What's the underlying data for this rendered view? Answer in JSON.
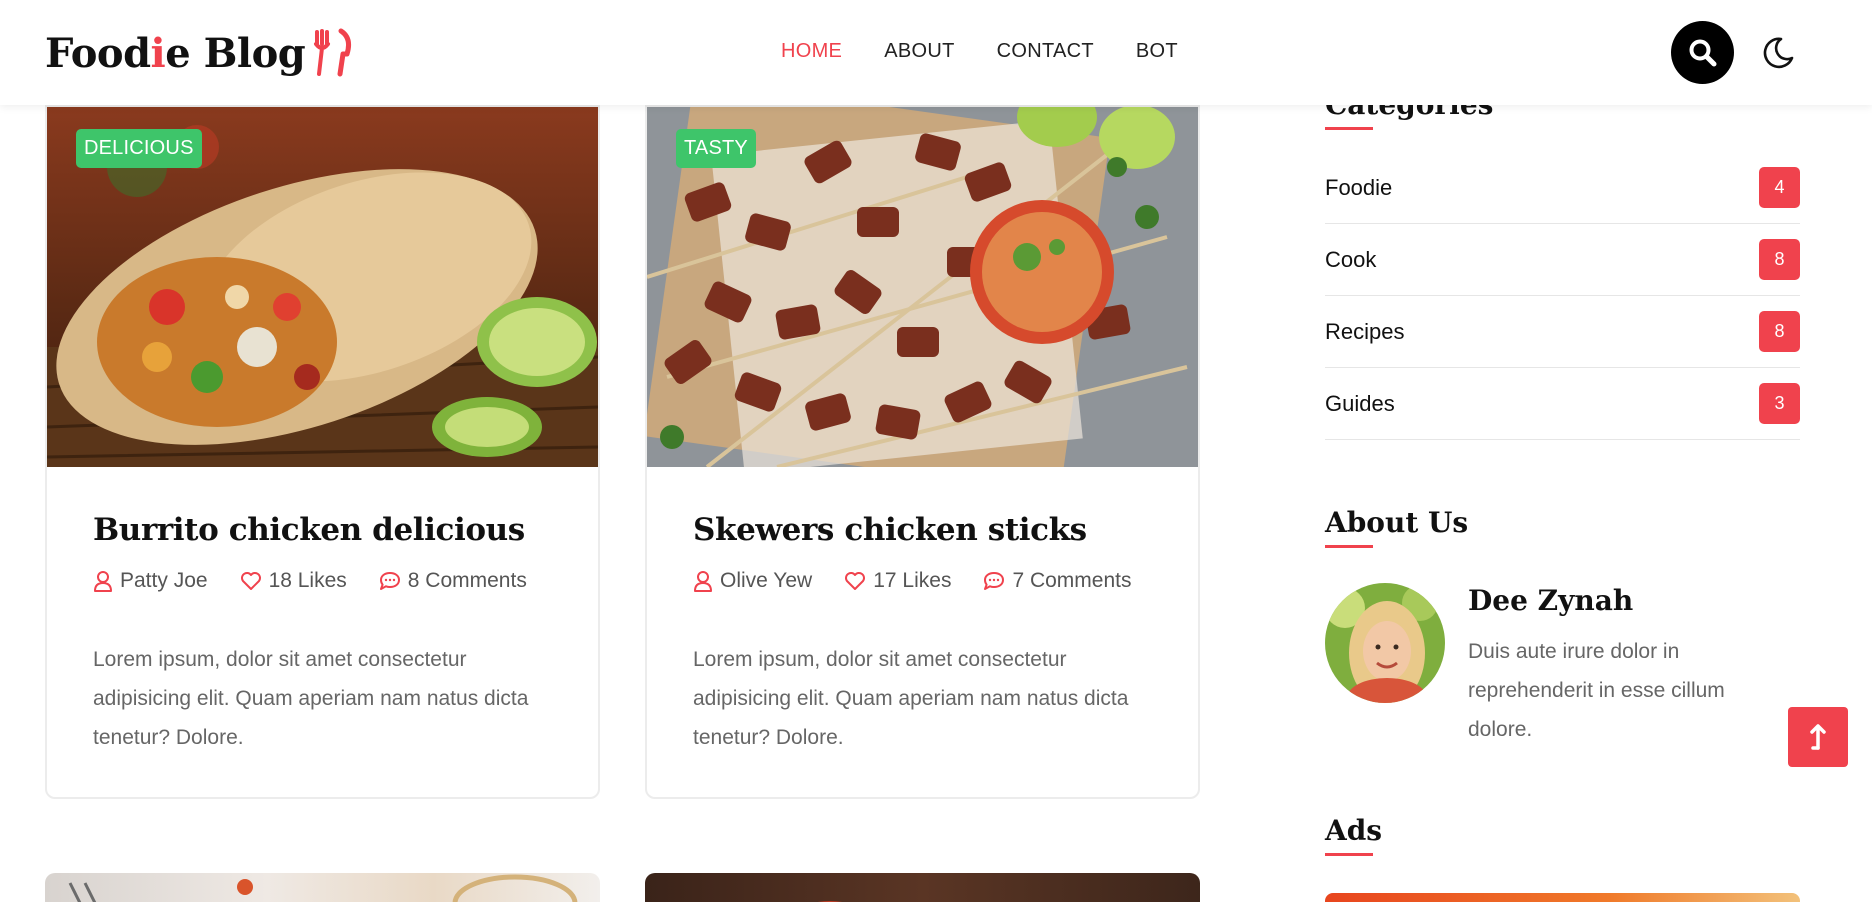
{
  "header": {
    "logo_part1": "Food",
    "logo_accent": "i",
    "logo_part2": "e Blog",
    "nav": [
      {
        "label": "HOME",
        "active": true
      },
      {
        "label": "ABOUT",
        "active": false
      },
      {
        "label": "CONTACT",
        "active": false
      },
      {
        "label": "BOT",
        "active": false
      }
    ],
    "icons": {
      "search": "search-icon",
      "theme": "moon-icon",
      "logo": "fork-knife-icon"
    }
  },
  "posts": [
    {
      "tag": "DELICIOUS",
      "title": "Burrito chicken delicious",
      "author": "Patty Joe",
      "likes": "18 Likes",
      "comments": "8 Comments",
      "excerpt": "Lorem ipsum, dolor sit amet consectetur adipisicing elit. Quam aperiam nam natus dicta tenetur? Dolore."
    },
    {
      "tag": "TASTY",
      "title": "Skewers chicken sticks",
      "author": "Olive Yew",
      "likes": "17 Likes",
      "comments": "7 Comments",
      "excerpt": "Lorem ipsum, dolor sit amet consectetur adipisicing elit. Quam aperiam nam natus dicta tenetur? Dolore."
    }
  ],
  "sidebar": {
    "categories_heading": "Categories",
    "categories": [
      {
        "name": "Foodie",
        "count": "4"
      },
      {
        "name": "Cook",
        "count": "8"
      },
      {
        "name": "Recipes",
        "count": "8"
      },
      {
        "name": "Guides",
        "count": "3"
      }
    ],
    "about_heading": "About Us",
    "about_name": "Dee Zynah",
    "about_text": "Duis aute irure dolor in reprehenderit in esse cillum dolore.",
    "ads_heading": "Ads"
  },
  "colors": {
    "accent": "#f0424d",
    "tag": "#3ec56a",
    "text": "#111111",
    "muted": "#666666"
  }
}
